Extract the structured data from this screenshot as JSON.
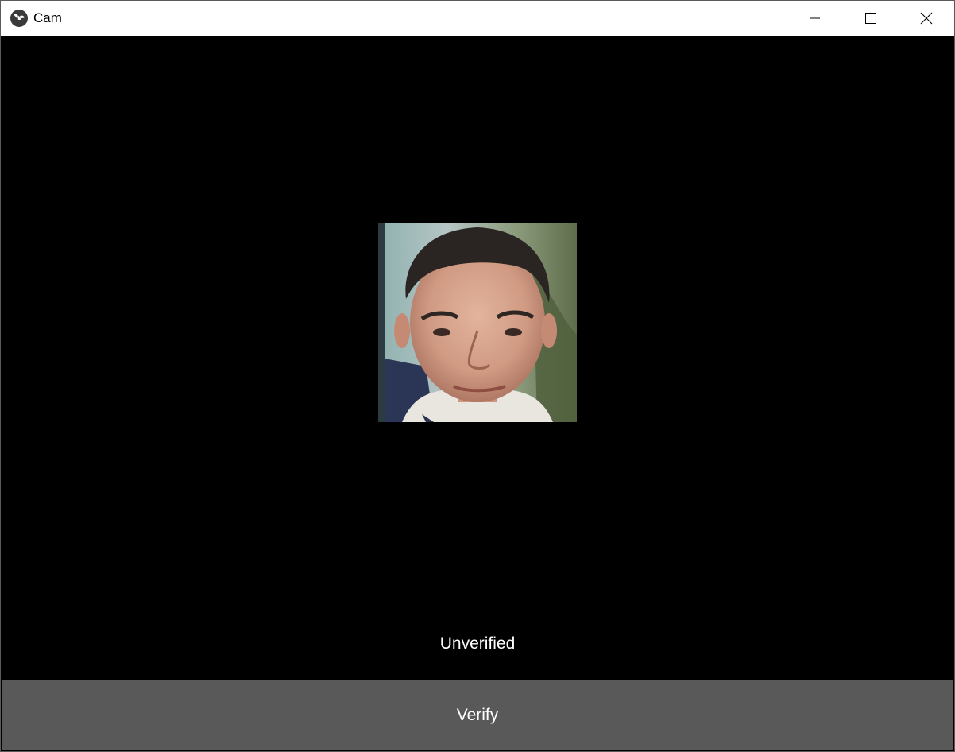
{
  "window": {
    "title": "Cam",
    "app_icon": "kivy-logo-icon",
    "controls": {
      "minimize": "minimize-icon",
      "maximize": "maximize-icon",
      "close": "close-icon"
    }
  },
  "main": {
    "status_text": "Unverified",
    "verify_button_label": "Verify"
  },
  "colors": {
    "background": "#000000",
    "button": "#595959",
    "text": "#ffffff"
  }
}
